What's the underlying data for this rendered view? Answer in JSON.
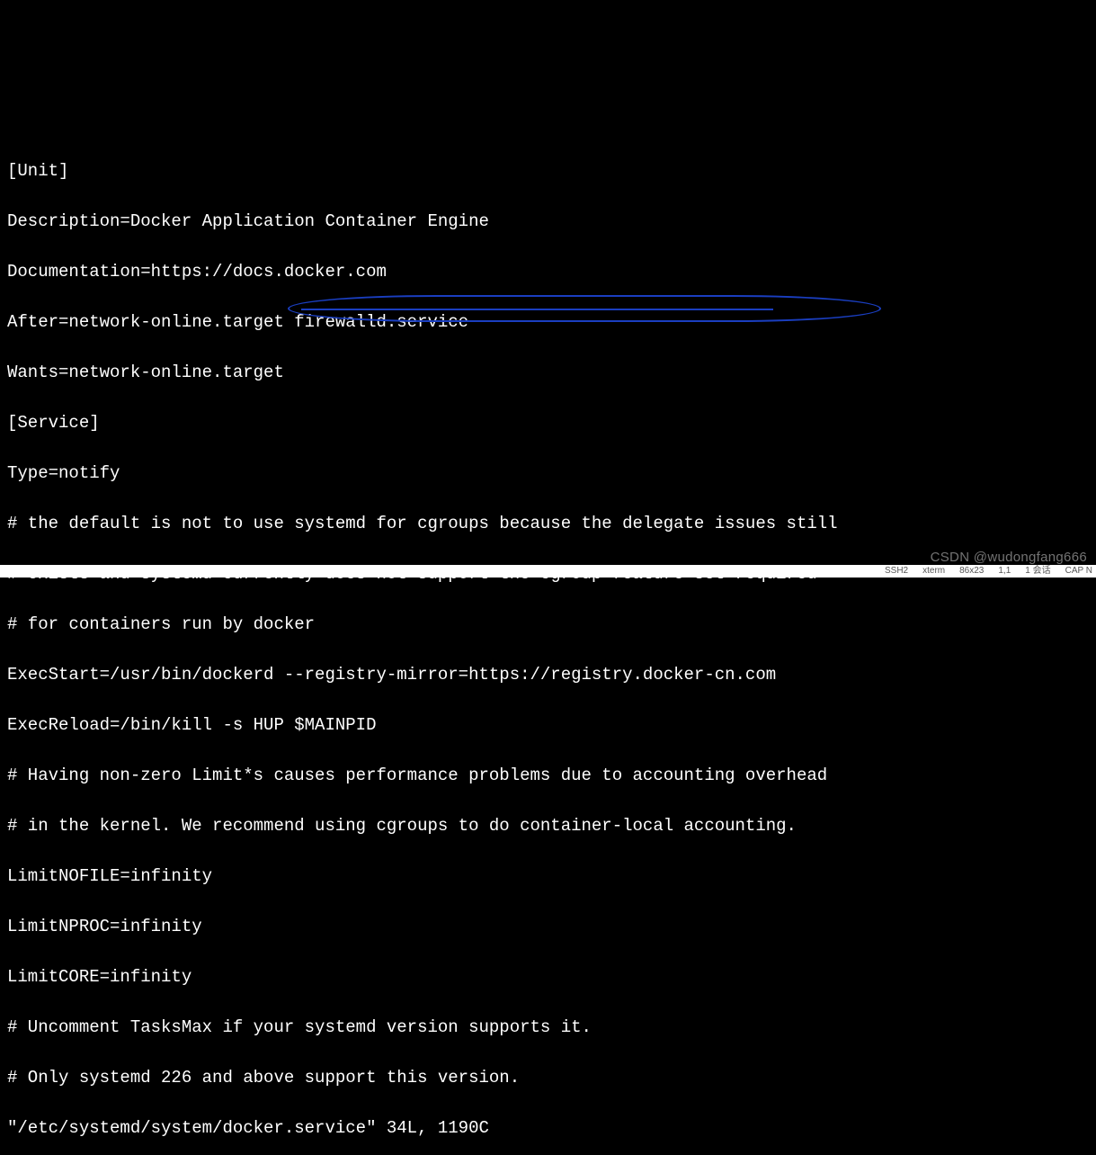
{
  "terminal": {
    "lines": [
      "[Unit]",
      "Description=Docker Application Container Engine",
      "Documentation=https://docs.docker.com",
      "After=network-online.target firewalld.service",
      "Wants=network-online.target",
      "[Service]",
      "Type=notify",
      "# the default is not to use systemd for cgroups because the delegate issues still",
      "# exists and systemd currently does not support the cgroup feature set required",
      "# for containers run by docker",
      "ExecStart=/usr/bin/dockerd --registry-mirror=https://registry.docker-cn.com",
      "ExecReload=/bin/kill -s HUP $MAINPID",
      "# Having non-zero Limit*s causes performance problems due to accounting overhead",
      "# in the kernel. We recommend using cgroups to do container-local accounting.",
      "LimitNOFILE=infinity",
      "LimitNPROC=infinity",
      "LimitCORE=infinity",
      "# Uncomment TasksMax if your systemd version supports it.",
      "# Only systemd 226 and above support this version.",
      "\"/etc/systemd/system/docker.service\" 34L, 1190C"
    ]
  },
  "annotation": {
    "circled_text": "--registry-mirror=https://registry.docker-cn.com"
  },
  "watermark": "CSDN @wudongfang666",
  "status": {
    "ssh": "SSH2",
    "term": "xterm",
    "size": "86x23",
    "pos": "1,1",
    "session": "1 会话",
    "cap": "CAP  N"
  }
}
